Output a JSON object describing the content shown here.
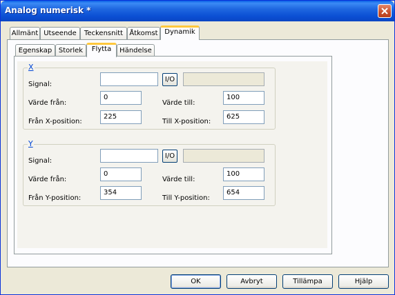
{
  "window": {
    "title": "Analog numerisk *"
  },
  "tabs": [
    "Allmänt",
    "Utseende",
    "Teckensnitt",
    "Åtkomst",
    "Dynamik"
  ],
  "active_tab": "Dynamik",
  "subtabs": [
    "Egenskap",
    "Storlek",
    "Flytta",
    "Händelse"
  ],
  "active_subtab": "Flytta",
  "x_group": {
    "label": "X",
    "signal_label": "Signal:",
    "signal_value": "",
    "io_label": "I/O",
    "from_label": "Värde från:",
    "from_value": "0",
    "to_label": "Värde till:",
    "to_value": "100",
    "from_pos_label": "Från X-position:",
    "from_pos_value": "225",
    "to_pos_label": "Till X-position:",
    "to_pos_value": "625"
  },
  "y_group": {
    "label": "Y",
    "signal_label": "Signal:",
    "signal_value": "",
    "io_label": "I/O",
    "from_label": "Värde från:",
    "from_value": "0",
    "to_label": "Värde till:",
    "to_value": "100",
    "from_pos_label": "Från Y-position:",
    "from_pos_value": "354",
    "to_pos_label": "Till Y-position:",
    "to_pos_value": "654"
  },
  "buttons": {
    "ok": "OK",
    "cancel": "Avbryt",
    "apply": "Tillämpa",
    "help": "Hjälp"
  }
}
